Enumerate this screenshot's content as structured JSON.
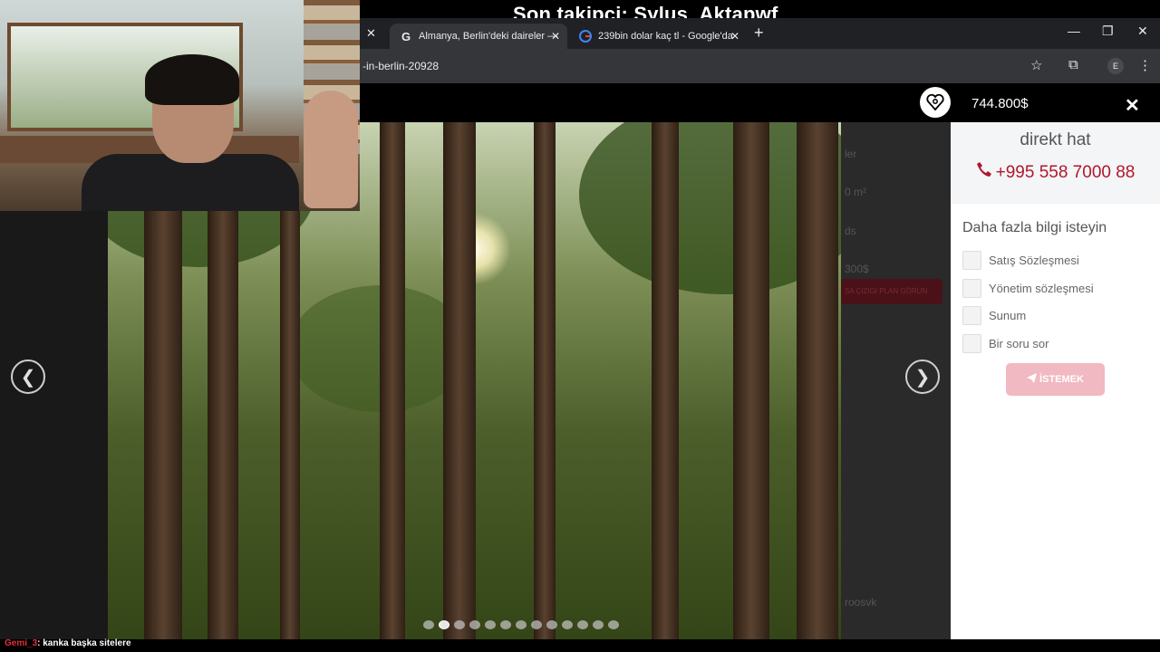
{
  "stream": {
    "title": "Son takipçi: Sylus_Aktapwf",
    "chat_user": "Gemi_3",
    "chat_message": ": kanka başka sitelere"
  },
  "browser": {
    "tabs": [
      {
        "label": "Almanya, Berlin'deki daireler —",
        "icon": "g-logo-icon",
        "active": true
      },
      {
        "label": "239bin dolar kaç tl - Google'da",
        "icon": "google-icon",
        "active": false
      }
    ],
    "url": "-in-berlin-20928",
    "new_tab": "+",
    "profile_initial": "E"
  },
  "listing": {
    "price": "744.800$",
    "faded_lines": [
      "ler",
      "0 m²",
      "ds",
      "300$",
      "roosvk"
    ],
    "faded_button": "SA ÇIZIGI PLAN GÖRÜN"
  },
  "gallery": {
    "prev": "❮",
    "next": "❯",
    "dot_count": 13,
    "active_dot": 1
  },
  "panel": {
    "direct_line": "direkt hat",
    "phone": "+995 558 7000 88",
    "more_info": "Daha fazla bilgi isteyin",
    "options": [
      "Satış Sözleşmesi",
      "Yönetim sözleşmesi",
      "Sunum",
      "Bir soru sor"
    ],
    "submit": "İSTEMEK"
  },
  "colors": {
    "accent": "#b0172e",
    "submit_disabled": "#f1b9c1"
  }
}
